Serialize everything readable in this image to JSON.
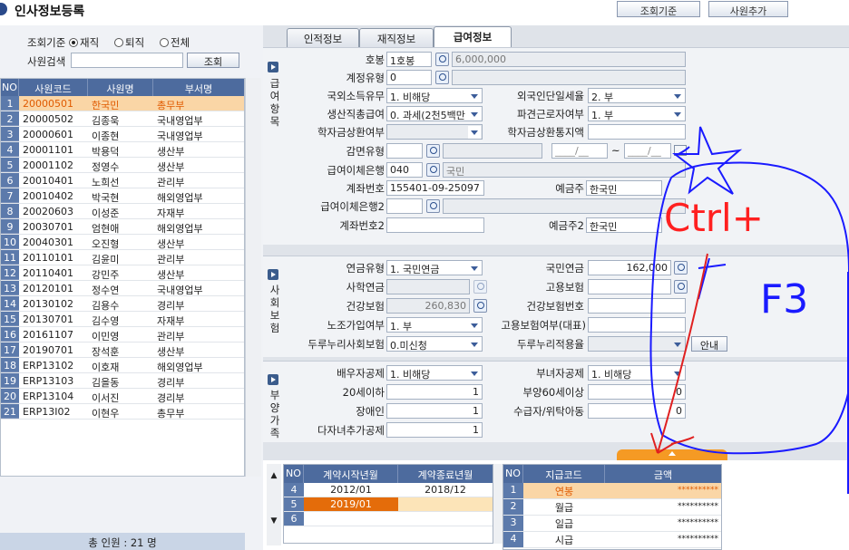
{
  "window": {
    "title": "인사정보등록"
  },
  "toolbar": {
    "lookup_criteria_btn": "조회기준",
    "add_employee_btn": "사원추가"
  },
  "filter": {
    "criteria_label": "조회기준",
    "options": [
      "재직",
      "퇴직",
      "전체"
    ],
    "selected": "재직",
    "search_label": "사원검색",
    "search_value": "",
    "search_btn": "조회"
  },
  "employee_grid": {
    "columns": [
      "NO",
      "사원코드",
      "사원명",
      "부서명"
    ],
    "rows": [
      {
        "no": "1",
        "code": "20000501",
        "name": "한국민",
        "dept": "총무부"
      },
      {
        "no": "2",
        "code": "20000502",
        "name": "김종욱",
        "dept": "국내영업부"
      },
      {
        "no": "3",
        "code": "20000601",
        "name": "이종현",
        "dept": "국내영업부"
      },
      {
        "no": "4",
        "code": "20001101",
        "name": "박용덕",
        "dept": "생산부"
      },
      {
        "no": "5",
        "code": "20001102",
        "name": "정영수",
        "dept": "생산부"
      },
      {
        "no": "6",
        "code": "20010401",
        "name": "노희선",
        "dept": "관리부"
      },
      {
        "no": "7",
        "code": "20010402",
        "name": "박국현",
        "dept": "해외영업부"
      },
      {
        "no": "8",
        "code": "20020603",
        "name": "이성준",
        "dept": "자재부"
      },
      {
        "no": "9",
        "code": "20030701",
        "name": "엄현애",
        "dept": "해외영업부"
      },
      {
        "no": "10",
        "code": "20040301",
        "name": "오진형",
        "dept": "생산부"
      },
      {
        "no": "11",
        "code": "20110101",
        "name": "김윤미",
        "dept": "관리부"
      },
      {
        "no": "12",
        "code": "20110401",
        "name": "강민주",
        "dept": "생산부"
      },
      {
        "no": "13",
        "code": "20120101",
        "name": "정수연",
        "dept": "국내영업부"
      },
      {
        "no": "14",
        "code": "20130102",
        "name": "김용수",
        "dept": "경리부"
      },
      {
        "no": "15",
        "code": "20130701",
        "name": "김수영",
        "dept": "자재부"
      },
      {
        "no": "16",
        "code": "20161107",
        "name": "이민영",
        "dept": "관리부"
      },
      {
        "no": "17",
        "code": "20190701",
        "name": "장석훈",
        "dept": "생산부"
      },
      {
        "no": "18",
        "code": "ERP13102",
        "name": "이호재",
        "dept": "해외영업부"
      },
      {
        "no": "19",
        "code": "ERP13103",
        "name": "김을동",
        "dept": "경리부"
      },
      {
        "no": "20",
        "code": "ERP13104",
        "name": "이서진",
        "dept": "경리부"
      },
      {
        "no": "21",
        "code": "ERP13I02",
        "name": "이현우",
        "dept": "총무부"
      }
    ],
    "total": "총 인원 : 21 명"
  },
  "tabs": [
    "인적정보",
    "재직정보",
    "급여정보"
  ],
  "active_tab": "급여정보",
  "pay_section": {
    "side_label": "급여항목",
    "pay_grade_label": "호봉",
    "pay_grade_value": "1호봉",
    "pay_grade_amount": "6,000,000",
    "contract_type_label": "계정유형",
    "contract_type_value": "0",
    "foreign_income_label": "국외소득유무",
    "foreign_income_value": "1. 비해당",
    "foreigner_tax_label": "외국인단일세율",
    "foreigner_tax_value": "2. 부",
    "production_pay_label": "생산직총급여",
    "production_pay_value": "0. 과세(2천5백만",
    "dispatch_label": "파견근로자여부",
    "dispatch_value": "1. 부",
    "student_loan_label": "학자금상환여부",
    "student_loan_value": "",
    "student_loan_region_label": "학자금상환통지액",
    "student_loan_region_value": "",
    "reduction_label": "감면유형",
    "reduction_value": "",
    "date_from": "____/__",
    "date_sep": "~",
    "date_to": "____/__",
    "bank_label": "급여이체은행",
    "bank_code": "040",
    "bank_name": "국민",
    "account_label": "계좌번호",
    "account_value": "155401-09-25097",
    "depositor_label": "예금주",
    "depositor_value": "한국민",
    "bank2_label": "급여이체은행2",
    "bank2_code": "",
    "account2_label": "계좌번호2",
    "account2_value": "",
    "depositor2_label": "예금주2",
    "depositor2_value": "한국민"
  },
  "insurance_section": {
    "side_label": "사회보험",
    "pension_type_label": "연금유형",
    "pension_type_value": "1. 국민연금",
    "national_pension_label": "국민연금",
    "national_pension_value": "162,000",
    "private_pension_label": "사학연금",
    "private_pension_value": "",
    "employment_ins_label": "고용보험",
    "employment_ins_value": "",
    "health_ins_label": "건강보험",
    "health_ins_value": "260,830",
    "health_ins_no_label": "건강보험번호",
    "health_ins_no_value": "",
    "union_label": "노조가입여부",
    "union_value": "1. 부",
    "emp_ins_rep_label": "고용보험여부(대표)",
    "emp_ins_rep_value": "",
    "durunuri_label": "두루누리사회보험",
    "durunuri_value": "0.미신청",
    "durunuri_rate_label": "두루누리적용율",
    "durunuri_rate_value": "",
    "guide_btn": "안내"
  },
  "dependents_section": {
    "side_label": "부양가족",
    "spouse_label": "배우자공제",
    "spouse_value": "1. 비해당",
    "female_label": "부녀자공제",
    "female_value": "1. 비해당",
    "under20_label": "20세이하",
    "under20_value": "1",
    "over60_label": "부양60세이상",
    "over60_value": "0",
    "disabled_label": "장애인",
    "disabled_value": "1",
    "welfare_label": "수급자/위탁아동",
    "welfare_value": "0",
    "multichild_label": "다자녀추가공제",
    "multichild_value": "1"
  },
  "contract_grid": {
    "columns": [
      "NO",
      "계약시작년월",
      "계약종료년월"
    ],
    "rows": [
      {
        "no": "4",
        "start": "2012/01",
        "end": "2018/12"
      },
      {
        "no": "5",
        "start": "2019/01",
        "end": ""
      },
      {
        "no": "6",
        "start": "",
        "end": ""
      }
    ]
  },
  "pay_code_grid": {
    "columns": [
      "NO",
      "지급코드",
      "금액"
    ],
    "rows": [
      {
        "no": "1",
        "code": "연봉",
        "amount": "**********"
      },
      {
        "no": "2",
        "code": "월급",
        "amount": "**********"
      },
      {
        "no": "3",
        "code": "일급",
        "amount": "**********"
      },
      {
        "no": "4",
        "code": "시급",
        "amount": "**********"
      }
    ]
  },
  "annotation": {
    "text_line1": "Ctrl+",
    "text_line2": "F3",
    "color": "#1a1aff",
    "arrow_color": "#e02020"
  },
  "colors": {
    "header_blue": "#4d6b9e",
    "selected_row": "#fad6a6",
    "accent_orange": "#f59a24"
  }
}
